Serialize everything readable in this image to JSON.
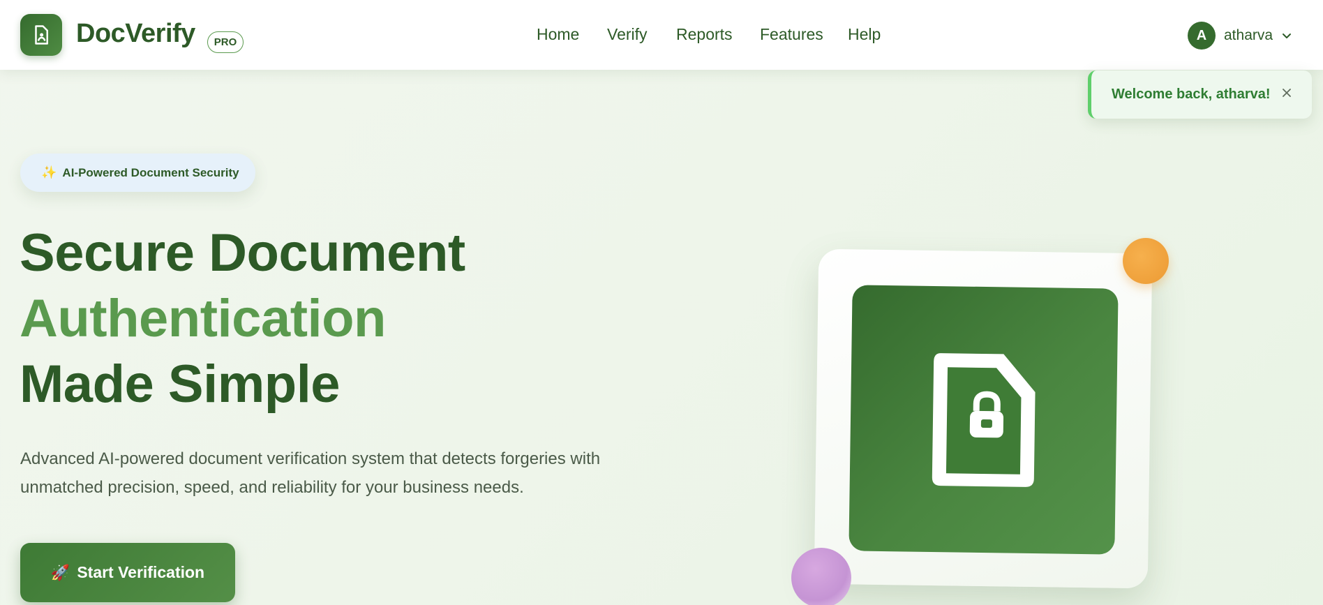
{
  "header": {
    "brand": "DocVerify",
    "badge": "PRO",
    "logo_icon": "document-user-icon",
    "nav": [
      "Home",
      "Verify",
      "Reports",
      "Features",
      "Help"
    ],
    "user": {
      "initial": "A",
      "name": "atharva",
      "menu_icon": "chevron-down-icon"
    }
  },
  "toast": {
    "message": "Welcome back, atharva!",
    "close_icon": "close-icon"
  },
  "hero": {
    "badge": {
      "icon": "✨",
      "text": "AI-Powered Document Security"
    },
    "title_line1": "Secure Document",
    "title_line2": "Authentication",
    "title_line3": "Made Simple",
    "description": "Advanced AI-powered document verification system that detects forgeries with unmatched precision, speed, and reliability for your business needs.",
    "cta": {
      "icon": "🚀",
      "label": "Start Verification"
    }
  },
  "illustration": {
    "icon": "document-lock-icon"
  },
  "colors": {
    "primary_dark": "#2d5a27",
    "primary_light": "#5a9a4e",
    "toast_accent": "#5fcf6b",
    "orb_orange": "#ec9a33",
    "orb_purple": "#c594d4"
  }
}
